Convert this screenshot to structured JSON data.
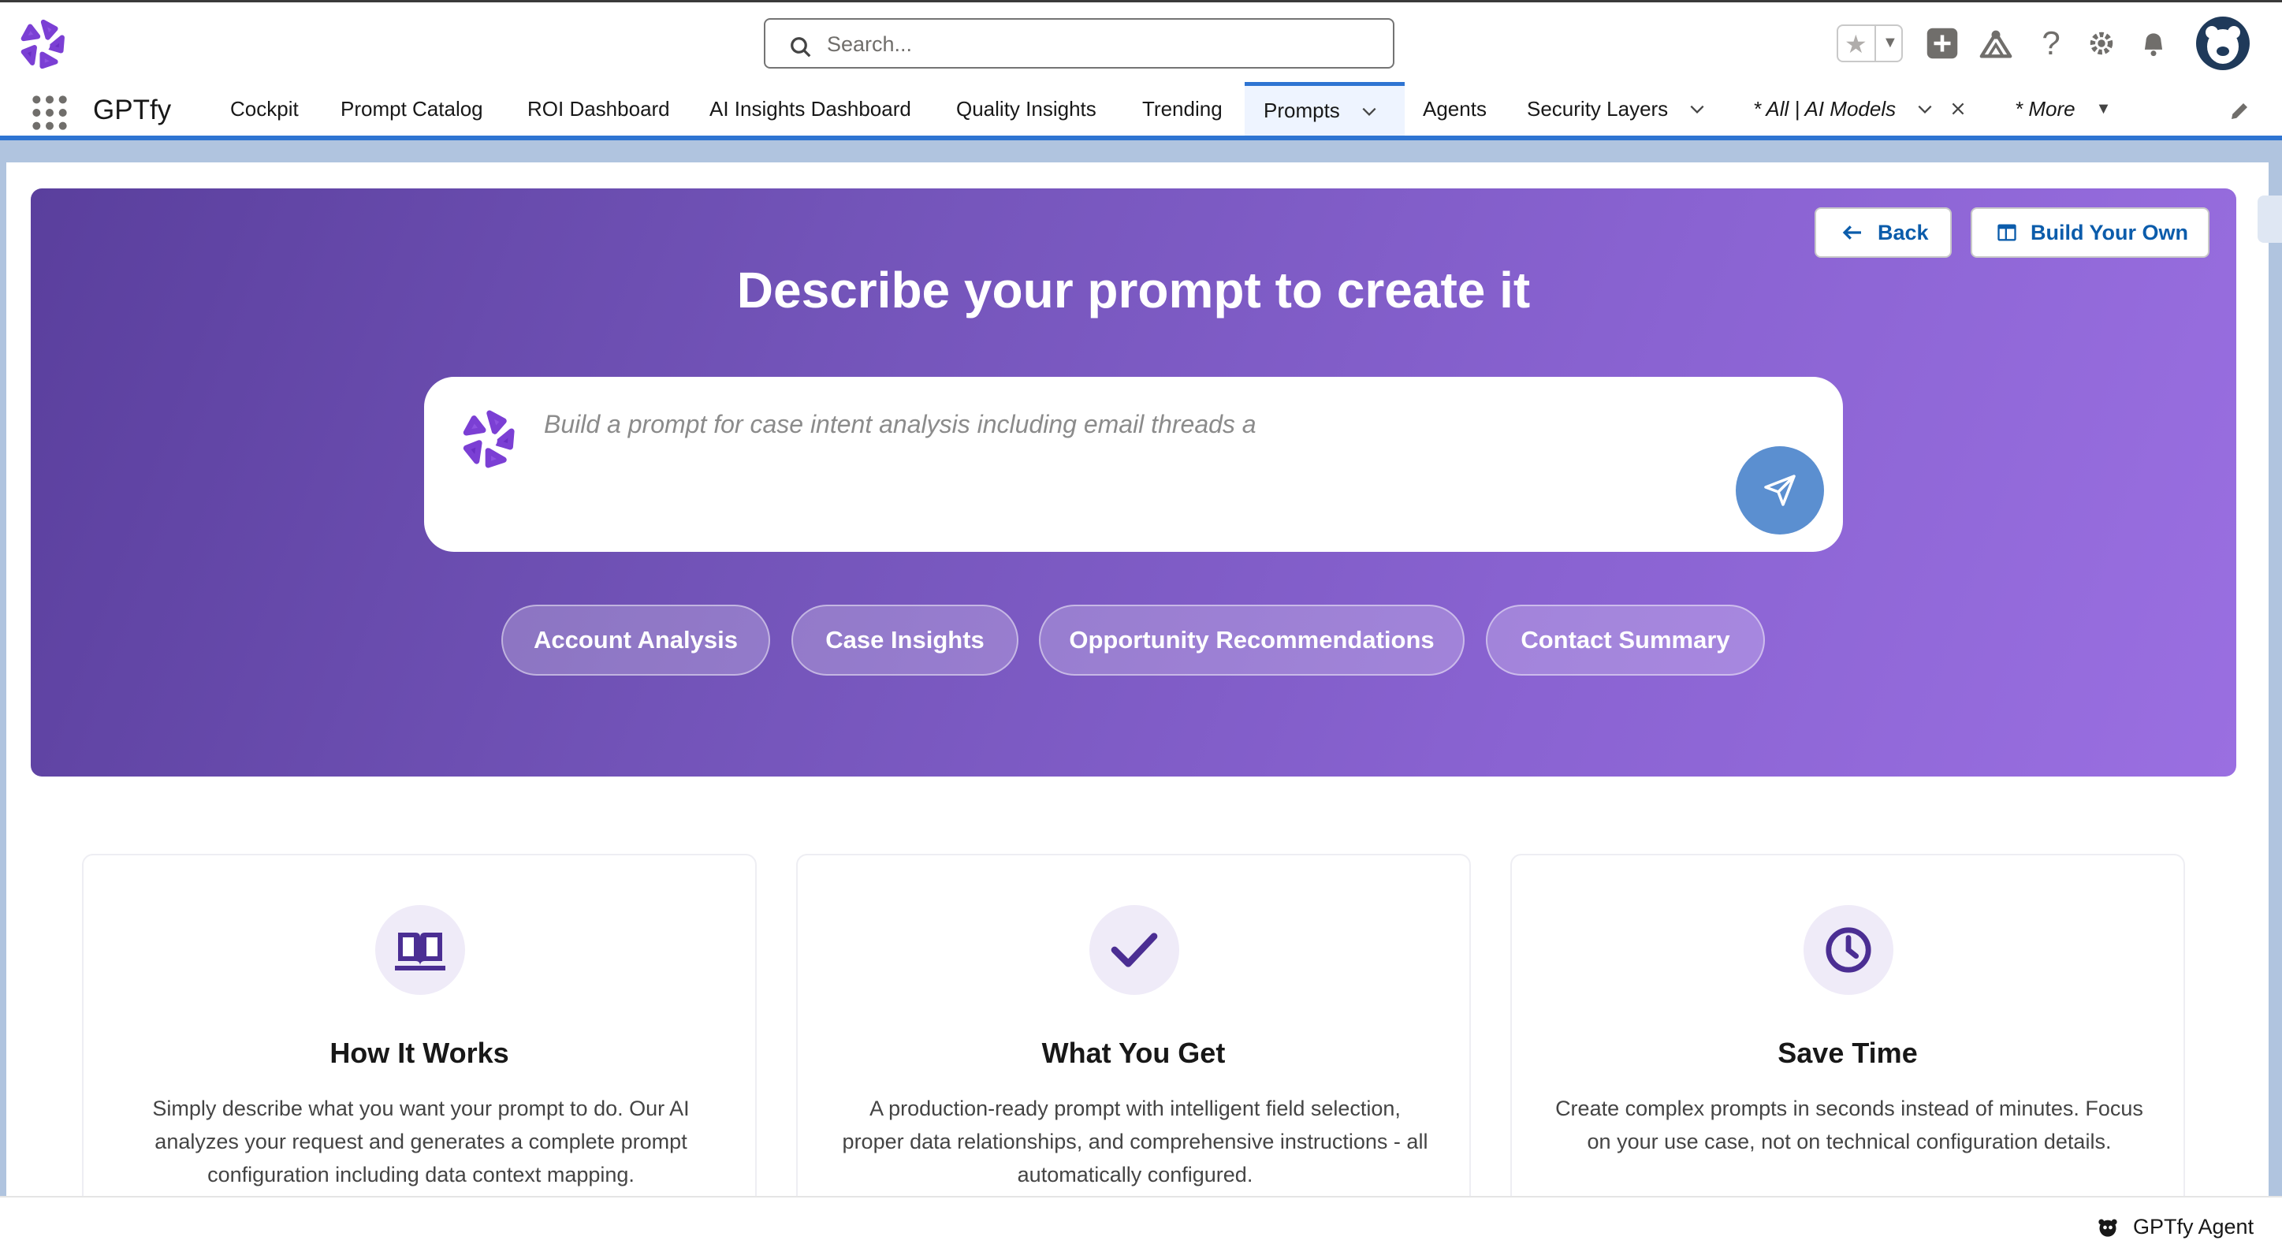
{
  "header": {
    "search_placeholder": "Search..."
  },
  "nav": {
    "app_name": "GPTfy",
    "tabs": [
      {
        "label": "Cockpit"
      },
      {
        "label": "Prompt Catalog"
      },
      {
        "label": "ROI Dashboard"
      },
      {
        "label": "AI Insights Dashboard"
      },
      {
        "label": "Quality Insights"
      },
      {
        "label": "Trending"
      },
      {
        "label": "Prompts",
        "active": true
      },
      {
        "label": "Agents"
      },
      {
        "label": "Security Layers"
      },
      {
        "label": "* All | AI Models"
      },
      {
        "label": "* More"
      }
    ]
  },
  "hero": {
    "back_label": "Back",
    "build_label": "Build Your Own",
    "title": "Describe your prompt to create it",
    "prompt_placeholder": "Build a prompt for case intent analysis including email threads a",
    "chips": [
      "Account Analysis",
      "Case Insights",
      "Opportunity Recommendations",
      "Contact Summary"
    ]
  },
  "cards": [
    {
      "icon": "book-icon",
      "title": "How It Works",
      "text": "Simply describe what you want your prompt to do. Our AI analyzes your request and generates a complete prompt configuration including data context mapping."
    },
    {
      "icon": "checkmark-icon",
      "title": "What You Get",
      "text": "A production-ready prompt with intelligent field selection, proper data relationships, and comprehensive instructions - all automatically configured."
    },
    {
      "icon": "clock-icon",
      "title": "Save Time",
      "text": "Create complex prompts in seconds instead of minutes. Focus on your use case, not on technical configuration details."
    }
  ],
  "footer": {
    "agent_label": "GPTfy Agent"
  },
  "colors": {
    "brand_purple": "#6b4bb4",
    "accent_blue": "#2e74d2",
    "link_blue": "#0b5cab"
  }
}
